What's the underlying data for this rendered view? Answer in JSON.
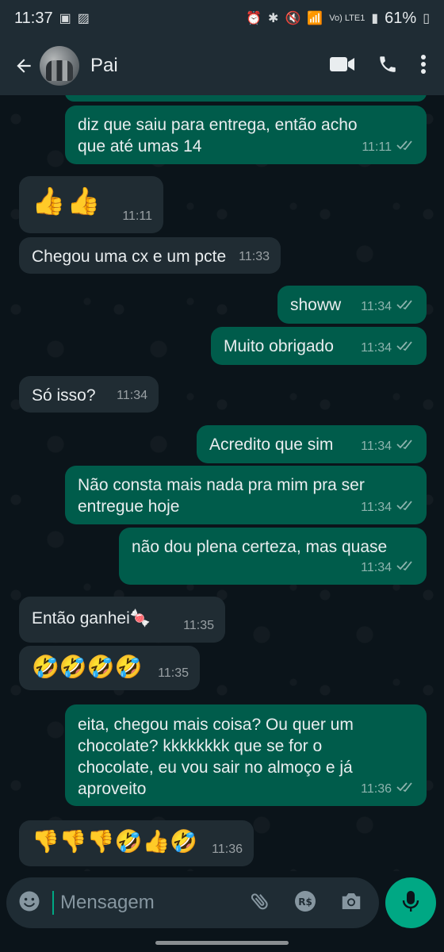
{
  "status_bar": {
    "time": "11:37",
    "network": "Vo) LTE1",
    "battery": "61%"
  },
  "header": {
    "contact_name": "Pai",
    "icons": [
      "back-arrow-icon",
      "video-call-icon",
      "phone-icon",
      "more-options-icon"
    ]
  },
  "messages": [
    {
      "direction": "out",
      "text": "diz que saiu para entrega, então acho\nque até umas 14",
      "time": "11:11",
      "status": "read"
    },
    {
      "direction": "in",
      "text": "👍👍",
      "time": "11:11"
    },
    {
      "direction": "in",
      "text": "Chegou uma cx e um pcte",
      "time": "11:33"
    },
    {
      "direction": "out",
      "text": "showw",
      "time": "11:34",
      "status": "read"
    },
    {
      "direction": "out",
      "text": "Muito obrigado",
      "time": "11:34",
      "status": "read"
    },
    {
      "direction": "in",
      "text": "Só isso?",
      "time": "11:34"
    },
    {
      "direction": "out",
      "text": "Acredito que sim",
      "time": "11:34",
      "status": "read"
    },
    {
      "direction": "out",
      "text": "Não consta mais nada pra mim pra ser\nentregue hoje",
      "time": "11:34",
      "status": "read"
    },
    {
      "direction": "out",
      "text": "não dou plena certeza, mas quase",
      "time": "11:34",
      "status": "read"
    },
    {
      "direction": "in",
      "text": "Então ganhei🍬",
      "time": "11:35"
    },
    {
      "direction": "in",
      "text": "🤣🤣🤣🤣",
      "time": "11:35"
    },
    {
      "direction": "out",
      "text": "eita, chegou mais coisa? Ou quer um\nchocolate? kkkkkkkk que se for o\nchocolate, eu vou sair no almoço e já\naproveito",
      "time": "11:36",
      "status": "read"
    },
    {
      "direction": "in",
      "text": "👎👎👎🤣👍🤣",
      "time": "11:36"
    }
  ],
  "composer": {
    "placeholder": "Mensagem",
    "icons": [
      "emoji-icon",
      "attach-icon",
      "payment-icon",
      "camera-icon",
      "mic-icon"
    ]
  },
  "colors": {
    "outgoing_bubble": "#005c4b",
    "incoming_bubble": "#202c33",
    "accent": "#00a884",
    "background": "#0b141a"
  }
}
